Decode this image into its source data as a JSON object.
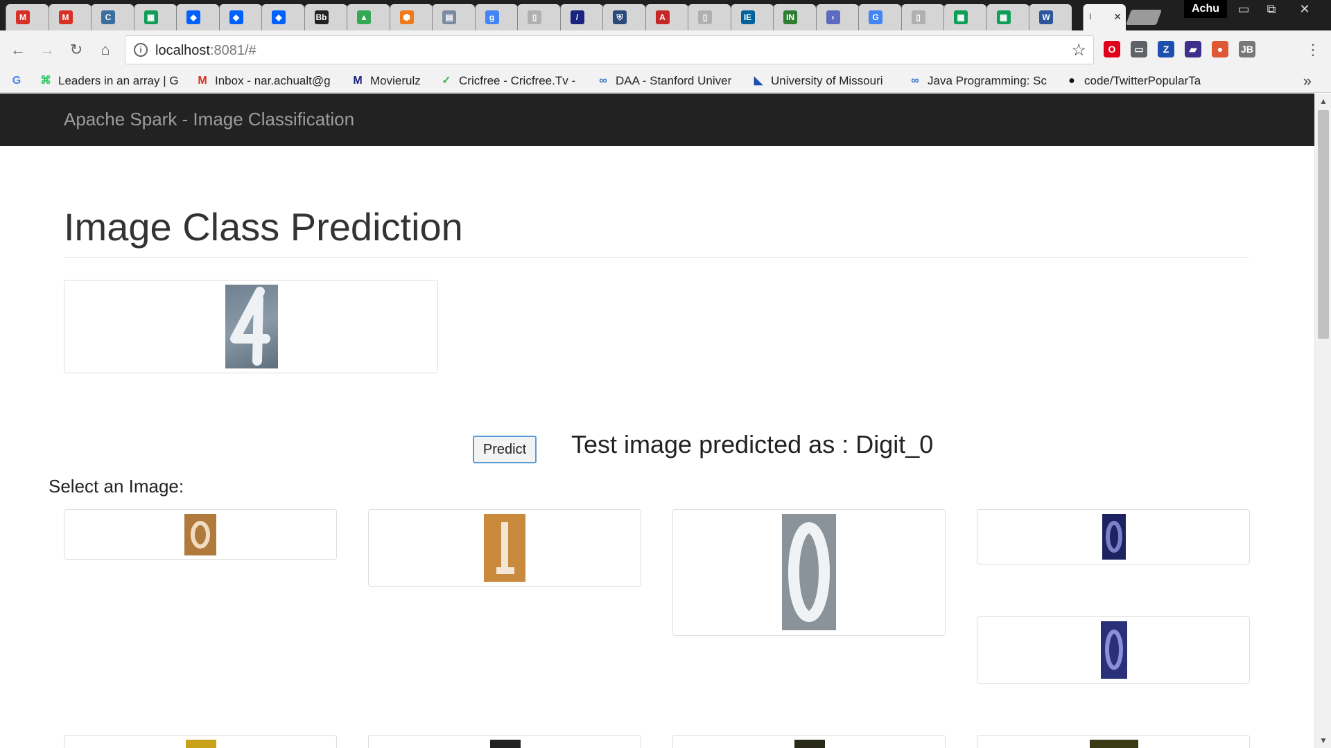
{
  "browser": {
    "profile_name": "Achu",
    "active_tab_caption": "I",
    "url_host": "localhost",
    "url_rest": ":8081/#",
    "tabs": [
      {
        "icon": "gmail-icon",
        "color": "#d93025",
        "glyph": "M"
      },
      {
        "icon": "gmail-icon",
        "color": "#d93025",
        "glyph": "M"
      },
      {
        "icon": "document-icon",
        "color": "#3c6e9e",
        "glyph": "C"
      },
      {
        "icon": "sheets-icon",
        "color": "#0f9d58",
        "glyph": "▦"
      },
      {
        "icon": "dropbox-icon",
        "color": "#0061ff",
        "glyph": "◆"
      },
      {
        "icon": "dropbox-icon",
        "color": "#0061ff",
        "glyph": "◆"
      },
      {
        "icon": "dropbox-icon",
        "color": "#0061ff",
        "glyph": "◆"
      },
      {
        "icon": "blackboard-icon",
        "color": "#222222",
        "glyph": "Bb"
      },
      {
        "icon": "drive-icon",
        "color": "#34a853",
        "glyph": "▲"
      },
      {
        "icon": "hexagon-icon",
        "color": "#f07a1a",
        "glyph": "⬢"
      },
      {
        "icon": "page-icon",
        "color": "#7a8aa0",
        "glyph": "▤"
      },
      {
        "icon": "google-scholar-icon",
        "color": "#4285f4",
        "glyph": "g"
      },
      {
        "icon": "blank-page-icon",
        "color": "#b0b0b0",
        "glyph": "▯"
      },
      {
        "icon": "pen-icon",
        "color": "#1a237e",
        "glyph": "/"
      },
      {
        "icon": "shield-icon",
        "color": "#2b4a7a",
        "glyph": "⛨"
      },
      {
        "icon": "pdf-icon",
        "color": "#c62828",
        "glyph": "A"
      },
      {
        "icon": "blank-page-icon",
        "color": "#b0b0b0",
        "glyph": "▯"
      },
      {
        "icon": "ieee-icon",
        "color": "#00629b",
        "glyph": "IE"
      },
      {
        "icon": "inj-icon",
        "color": "#2e7d32",
        "glyph": "IN"
      },
      {
        "icon": "arrow-icon",
        "color": "#5c6bc0",
        "glyph": "›"
      },
      {
        "icon": "google-icon",
        "color": "#4285f4",
        "glyph": "G"
      },
      {
        "icon": "blank-page-icon",
        "color": "#b0b0b0",
        "glyph": "▯"
      },
      {
        "icon": "sheets-icon",
        "color": "#0f9d58",
        "glyph": "▦"
      },
      {
        "icon": "sheets-icon",
        "color": "#0f9d58",
        "glyph": "▦"
      },
      {
        "icon": "word-icon",
        "color": "#2b579a",
        "glyph": "W"
      }
    ],
    "extensions": [
      {
        "icon": "opera-icon",
        "color": "#e0001b",
        "glyph": "O"
      },
      {
        "icon": "cast-icon",
        "color": "#5f6368",
        "glyph": "▭"
      },
      {
        "icon": "zotero-icon",
        "color": "#1e4fae",
        "glyph": "Z"
      },
      {
        "icon": "reader-icon",
        "color": "#3d2f8c",
        "glyph": "▰"
      },
      {
        "icon": "duckduckgo-icon",
        "color": "#de5833",
        "glyph": "●"
      },
      {
        "icon": "jb-icon",
        "color": "#777777",
        "glyph": "JB"
      }
    ],
    "bookmarks": [
      {
        "icon": "google-icon",
        "color": "#4285f4",
        "glyph": "G",
        "label": ""
      },
      {
        "icon": "hackerrank-icon",
        "color": "#2ec866",
        "glyph": "⌘",
        "label": "Leaders in an array | G"
      },
      {
        "icon": "gmail-icon",
        "color": "#d93025",
        "glyph": "M",
        "label": "Inbox - nar.achualt@g"
      },
      {
        "icon": "movierulz-icon",
        "color": "#1a237e",
        "glyph": "M",
        "label": "Movierulz"
      },
      {
        "icon": "cricfree-icon",
        "color": "#4caf50",
        "glyph": "✓",
        "label": "Cricfree - Cricfree.Tv -"
      },
      {
        "icon": "coursera-icon",
        "color": "#2a73cc",
        "glyph": "∞",
        "label": "DAA - Stanford Univer"
      },
      {
        "icon": "university-icon",
        "color": "#1e4fae",
        "glyph": "◣",
        "label": "University of Missouri"
      },
      {
        "icon": "coursera-icon",
        "color": "#2a73cc",
        "glyph": "∞",
        "label": "Java Programming: Sc"
      },
      {
        "icon": "github-icon",
        "color": "#111111",
        "glyph": "●",
        "label": "code/TwitterPopularTa"
      }
    ]
  },
  "page": {
    "brand": "Apache Spark - Image Classification",
    "heading": "Image Class Prediction",
    "predict_label": "Predict",
    "result_text": "Test image predicted as : Digit_0",
    "select_label": "Select an Image:"
  }
}
